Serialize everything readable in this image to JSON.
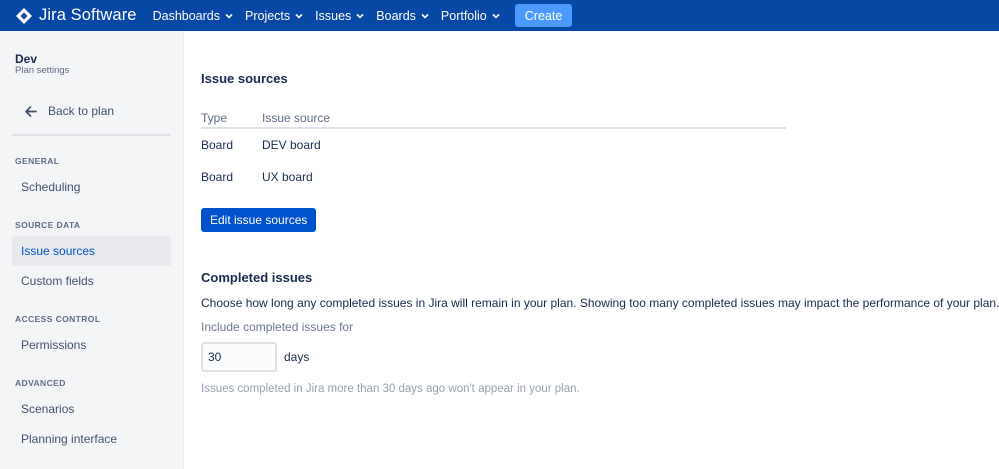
{
  "topnav": {
    "logo_text": "Jira Software",
    "items": [
      {
        "label": "Dashboards"
      },
      {
        "label": "Projects"
      },
      {
        "label": "Issues"
      },
      {
        "label": "Boards"
      },
      {
        "label": "Portfolio"
      }
    ],
    "create_label": "Create"
  },
  "sidebar": {
    "project_name": "Dev",
    "project_subtitle": "Plan settings",
    "back_label": "Back to plan",
    "sections": [
      {
        "title": "GENERAL",
        "items": [
          "Scheduling"
        ]
      },
      {
        "title": "SOURCE DATA",
        "items": [
          "Issue sources",
          "Custom fields"
        ]
      },
      {
        "title": "ACCESS CONTROL",
        "items": [
          "Permissions"
        ]
      },
      {
        "title": "ADVANCED",
        "items": [
          "Scenarios",
          "Planning interface"
        ]
      }
    ],
    "active_item": "Issue sources"
  },
  "issue_sources": {
    "heading": "Issue sources",
    "columns": [
      "Type",
      "Issue source"
    ],
    "rows": [
      [
        "Board",
        "DEV board"
      ],
      [
        "Board",
        "UX board"
      ]
    ],
    "edit_button": "Edit issue sources"
  },
  "completed_issues": {
    "heading": "Completed issues",
    "description": "Choose how long any completed issues in Jira will remain in your plan. Showing too many completed issues may impact the performance of your plan.",
    "field_label": "Include completed issues for",
    "field_value": "30",
    "unit": "days",
    "hint": "Issues completed in Jira more than 30 days ago won't appear in your plan."
  },
  "colors": {
    "nav_bg": "#0747a6",
    "create_bg": "#4c9aff",
    "primary": "#0052cc",
    "sidebar_bg": "#f4f5f7"
  }
}
